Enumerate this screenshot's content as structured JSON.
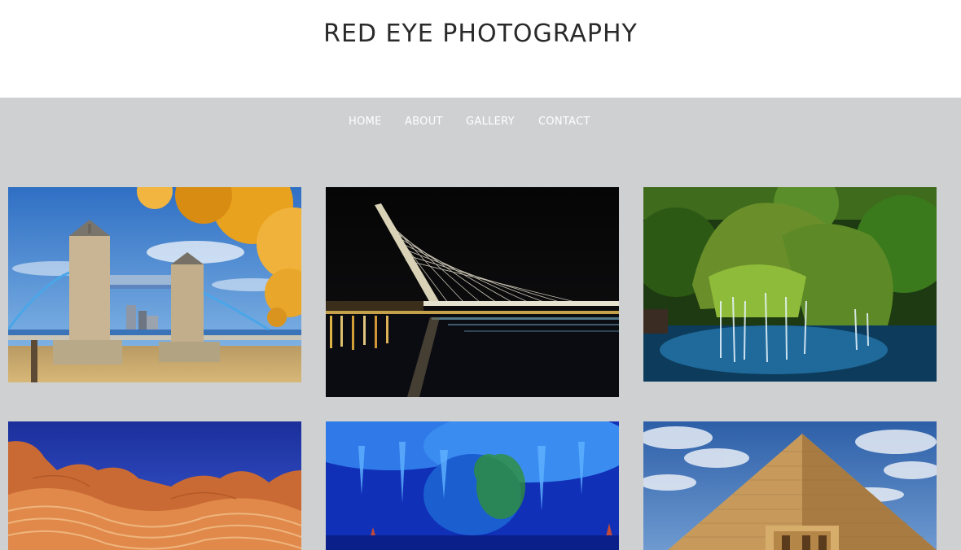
{
  "header": {
    "title": "RED EYE PHOTOGRAPHY"
  },
  "nav": {
    "items": [
      "HOME",
      "ABOUT",
      "GALLERY",
      "CONTACT"
    ]
  },
  "gallery": {
    "photos": [
      "tower-bridge-autumn",
      "illuminated-cable-bridge-night",
      "mossy-waterfall",
      "sandstone-wave-canyon",
      "blue-lit-cave",
      "great-pyramid"
    ]
  },
  "colors": {
    "header_bg": "#ffffff",
    "body_bg": "#cfd0d2",
    "title_text": "#2a2a2a",
    "nav_text": "#ffffff"
  }
}
